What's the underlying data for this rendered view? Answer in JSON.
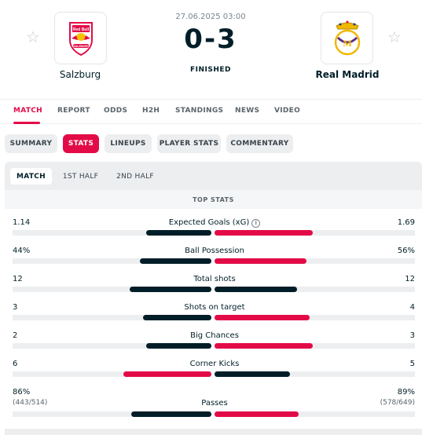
{
  "match": {
    "date": "27.06.2025 03:00",
    "score": "0-3",
    "status": "FINISHED",
    "home_team": "Salzburg",
    "away_team": "Real Madrid",
    "home_logo_text": "Red Bull",
    "home_logo_subtext": "SALZBURG"
  },
  "main_tabs": [
    {
      "label": "MATCH",
      "active": true
    },
    {
      "label": "REPORT"
    },
    {
      "label": "ODDS"
    },
    {
      "label": "H2H"
    },
    {
      "label": "STANDINGS"
    },
    {
      "label": "NEWS"
    },
    {
      "label": "VIDEO"
    }
  ],
  "sub_tabs": [
    {
      "label": "SUMMARY"
    },
    {
      "label": "STATS",
      "active": true
    },
    {
      "label": "LINEUPS"
    },
    {
      "label": "PLAYER STATS"
    },
    {
      "label": "COMMENTARY"
    }
  ],
  "period_tabs": [
    {
      "label": "MATCH",
      "active": true
    },
    {
      "label": "1ST HALF"
    },
    {
      "label": "2ND HALF"
    }
  ],
  "section_title": "TOP STATS",
  "colors": {
    "accent": "#e30b47",
    "dark": "#001e28"
  },
  "stats": [
    {
      "name": "Expected Goals (xG)",
      "home": "1.14",
      "away": "1.69",
      "home_frac": 0.4,
      "away_frac": 0.6,
      "info": true
    },
    {
      "name": "Ball Possession",
      "home": "44%",
      "away": "56%",
      "home_frac": 0.44,
      "away_frac": 0.56
    },
    {
      "name": "Total shots",
      "home": "12",
      "away": "12",
      "home_frac": 0.5,
      "away_frac": 0.5
    },
    {
      "name": "Shots on target",
      "home": "3",
      "away": "4",
      "home_frac": 0.42,
      "away_frac": 0.58
    },
    {
      "name": "Big Chances",
      "home": "2",
      "away": "3",
      "home_frac": 0.4,
      "away_frac": 0.6
    },
    {
      "name": "Corner Kicks",
      "home": "6",
      "away": "5",
      "home_frac": 0.54,
      "away_frac": 0.46
    },
    {
      "name": "Passes",
      "home": "86%",
      "away": "89%",
      "home_sub": "(443/514)",
      "away_sub": "(578/649)",
      "home_frac": 0.49,
      "away_frac": 0.51
    }
  ]
}
